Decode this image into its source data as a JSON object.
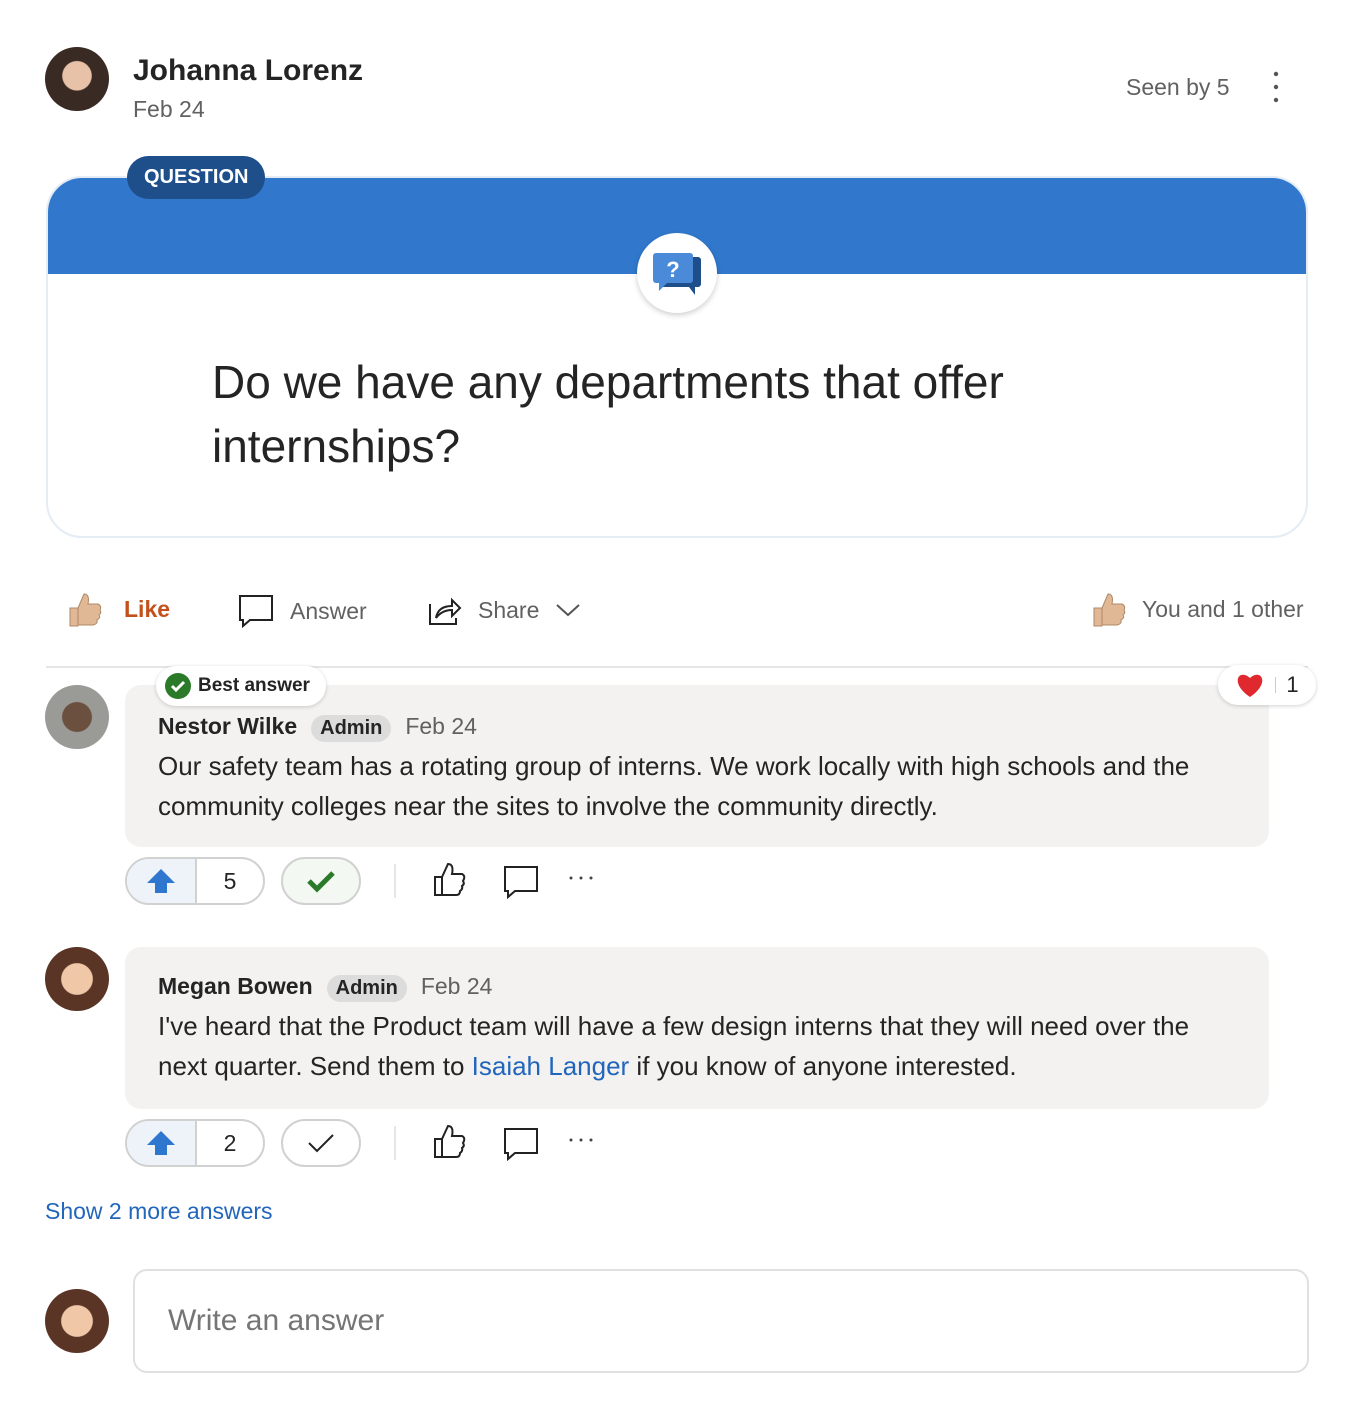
{
  "post": {
    "author": "Johanna Lorenz",
    "date": "Feb 24",
    "seen": "Seen by 5",
    "badge": "QUESTION",
    "question": "Do we have any departments that offer internships?"
  },
  "actions": {
    "like": "Like",
    "answer": "Answer",
    "share": "Share",
    "likes_summary": "You and 1 other"
  },
  "colors": {
    "accent": "#3178cd",
    "like": "#c4501b",
    "best": "#2a7a2a"
  },
  "answers": [
    {
      "author": "Nestor Wilke",
      "role": "Admin",
      "date": "Feb 24",
      "best_label": "Best answer",
      "text": "Our safety team has a rotating group of interns. We work locally with high schools and the community colleges near the sites to involve the community directly.",
      "votes": "5",
      "reaction_count": "1",
      "accepted": true
    },
    {
      "author": "Megan Bowen",
      "role": "Admin",
      "date": "Feb 24",
      "text_before": "I've heard that the Product team will have a few design interns that they will need over the next quarter. Send them to ",
      "mention": "Isaiah Langer",
      "text_after": " if you know of anyone interested.",
      "votes": "2",
      "accepted": false
    }
  ],
  "show_more": "Show 2 more answers",
  "composer": {
    "placeholder": "Write an answer"
  }
}
